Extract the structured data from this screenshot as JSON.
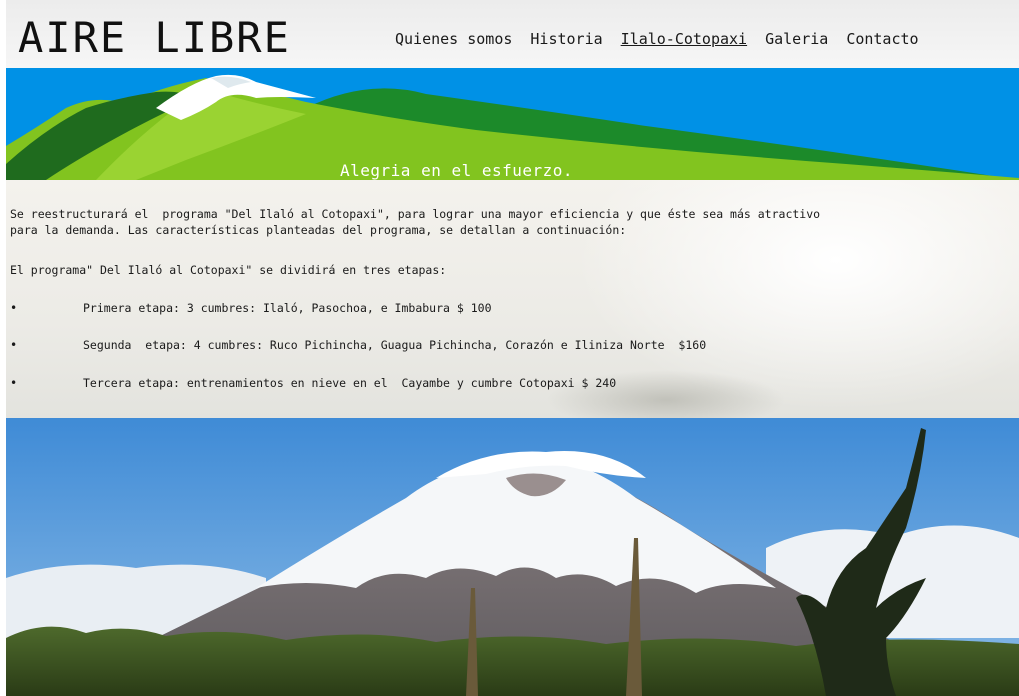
{
  "header": {
    "logo": "AIRE LIBRE",
    "nav": [
      {
        "label": "Quienes somos"
      },
      {
        "label": "Historia"
      },
      {
        "label": "Ilalo-Cotopaxi",
        "active": true
      },
      {
        "label": "Galeria"
      },
      {
        "label": "Contacto"
      }
    ]
  },
  "banner": {
    "tagline": "Alegria en el esfuerzo.",
    "colors": {
      "sky": "#0091e6",
      "light_green": "#7dc21e",
      "dark_green": "#1e7a2a",
      "snow": "#ffffff"
    }
  },
  "content": {
    "intro_line1": "Se reestructurará el  programa \"Del Ilaló al Cotopaxi\", para lograr una mayor eficiencia y que éste sea más atractivo",
    "intro_line2": "para la demanda. Las características planteadas del programa, se detallan a continuación:",
    "stages_intro": "El programa\" Del Ilaló al Cotopaxi\" se dividirá en tres etapas:",
    "bullet_symbol": "•",
    "stages": [
      {
        "text": "Primera etapa: 3 cumbres: Ilaló, Pasochoa, e Imbabura $ 100"
      },
      {
        "text": "Segunda  etapa: 4 cumbres: Ruco Pichincha, Guagua Pichincha, Corazón e Iliniza Norte  $160"
      },
      {
        "text": "Tercera etapa: entrenamientos en nieve en el  Cayambe y cumbre Cotopaxi $ 240"
      }
    ]
  },
  "photo": {
    "subject": "snow-capped-volcano-photo"
  }
}
